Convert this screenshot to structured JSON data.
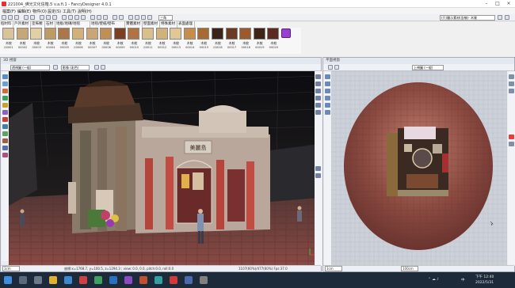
{
  "window": {
    "title": "221004_佛光文化信箱.5 v.a.fi.1 - FancyDesigner 4.0.1"
  },
  "menu": [
    "檔案(F)",
    "編輯(E)",
    "物件(O)",
    "設定(S)",
    "工具(T)",
    "說明(H)"
  ],
  "toolbar": {
    "view_select": "三角",
    "filter_select": "(只)顯示素材(含樣)- 木質"
  },
  "material_tabs": [
    "個材料",
    "戶外素材",
    "塗佈類",
    "石材",
    "地板/地磚/地毯",
    "地毯/壁紙/壁布",
    "實體素材",
    "壁面素材",
    "特殊素材",
    "表面處理"
  ],
  "materials": [
    {
      "label": "木紋",
      "code": "00001",
      "color": "#d9c39a"
    },
    {
      "label": "木紋",
      "code": "00002",
      "color": "#c7a677"
    },
    {
      "label": "木紋",
      "code": "00003",
      "color": "#e3cfa5"
    },
    {
      "label": "木紋",
      "code": "00004",
      "color": "#bf9a62"
    },
    {
      "label": "木紋",
      "code": "00005",
      "color": "#a9774a"
    },
    {
      "label": "木紋",
      "code": "00006",
      "color": "#d2b07c"
    },
    {
      "label": "木紋",
      "code": "00007",
      "color": "#caa576"
    },
    {
      "label": "木紋",
      "code": "00008",
      "color": "#c08f58"
    },
    {
      "label": "木紋",
      "code": "00009",
      "color": "#7a3f24"
    },
    {
      "label": "木紋",
      "code": "00010",
      "color": "#b07442"
    },
    {
      "label": "木紋",
      "code": "00011",
      "color": "#d9bf8c"
    },
    {
      "label": "木紋",
      "code": "00012",
      "color": "#d0b27b"
    },
    {
      "label": "木紋",
      "code": "00013",
      "color": "#e0c795"
    },
    {
      "label": "木紋",
      "code": "00014",
      "color": "#c78d4b"
    },
    {
      "label": "木紋",
      "code": "00015",
      "color": "#a86a33"
    },
    {
      "label": "木紋",
      "code": "00016",
      "color": "#3a2419"
    },
    {
      "label": "木紋",
      "code": "00017",
      "color": "#6b3a22"
    },
    {
      "label": "木紋",
      "code": "00018",
      "color": "#9b5a2d"
    },
    {
      "label": "木紋",
      "code": "00019",
      "color": "#3f2316"
    },
    {
      "label": "木紋",
      "code": "00020",
      "color": "#5c2a1f"
    }
  ],
  "left_viewport": {
    "title": "3D 視窗",
    "view_select": "透視圖 (一般)",
    "mode_select": "影像 (彩色)",
    "zoom_select": "1cm",
    "status": "座標:x=1768.7, y=100.5, z=1294.3 ; view: 0.0, 0.0, pitch:0.0, roll:0.0",
    "status_right": "1107(60%)/477(60%)  Fps:37.0",
    "signboard": "美麗島"
  },
  "right_viewport": {
    "title": "平面視窗",
    "view_select": "上視圖 (一般)",
    "zoom_select": "1cm",
    "zoom2_select": "100cm"
  },
  "taskbar": {
    "time": "下午 12:40",
    "date": "2022/5/31",
    "lang": "中"
  }
}
